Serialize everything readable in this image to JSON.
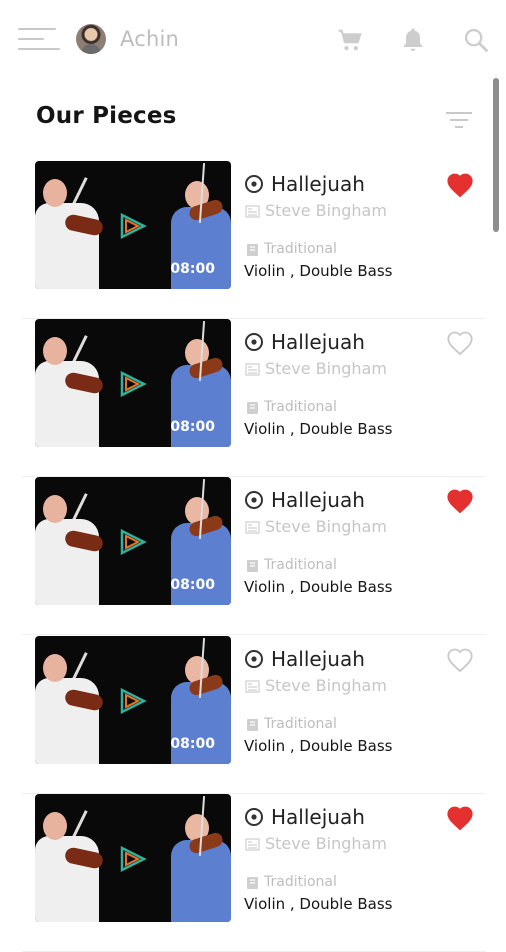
{
  "header": {
    "username": "Achin",
    "icons": [
      "menu-icon",
      "avatar",
      "cart-icon",
      "bell-icon",
      "search-icon"
    ]
  },
  "section": {
    "title": "Our Pieces",
    "filter_icon": "filter-icon"
  },
  "colors": {
    "favorite": "#e53030",
    "muted": "#c6c6c6",
    "text": "#161616"
  },
  "pieces": [
    {
      "title": "Hallejuah",
      "artist": "Steve Bingham",
      "genre": "Traditional",
      "instruments": "Violin , Double Bass",
      "duration": "08:00",
      "favorite": true
    },
    {
      "title": "Hallejuah",
      "artist": "Steve Bingham",
      "genre": "Traditional",
      "instruments": "Violin , Double Bass",
      "duration": "08:00",
      "favorite": false
    },
    {
      "title": "Hallejuah",
      "artist": "Steve Bingham",
      "genre": "Traditional",
      "instruments": "Violin , Double Bass",
      "duration": "08:00",
      "favorite": true
    },
    {
      "title": "Hallejuah",
      "artist": "Steve Bingham",
      "genre": "Traditional",
      "instruments": "Violin , Double Bass",
      "duration": "08:00",
      "favorite": false
    },
    {
      "title": "Hallejuah",
      "artist": "Steve Bingham",
      "genre": "Traditional",
      "instruments": "Violin , Double Bass",
      "duration": "",
      "favorite": true
    }
  ]
}
